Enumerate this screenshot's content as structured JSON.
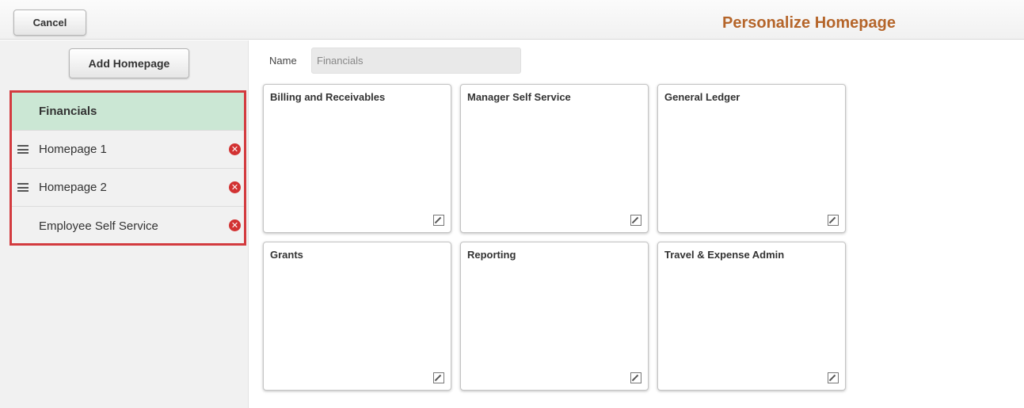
{
  "header": {
    "cancel_label": "Cancel",
    "title": "Personalize Homepage"
  },
  "sidebar": {
    "add_label": "Add Homepage",
    "items": [
      {
        "label": "Financials",
        "selected": true,
        "drag_icon": false,
        "delete_icon": false
      },
      {
        "label": "Homepage 1",
        "selected": false,
        "drag_icon": true,
        "delete_icon": true
      },
      {
        "label": "Homepage 2",
        "selected": false,
        "drag_icon": true,
        "delete_icon": true
      },
      {
        "label": "Employee Self Service",
        "selected": false,
        "drag_icon": false,
        "delete_icon": true
      }
    ],
    "delete_icon_glyph": "✕"
  },
  "main": {
    "name_label": "Name",
    "name_value": "Financials",
    "tiles": [
      {
        "title": "Billing and Receivables",
        "icon": "edit-icon"
      },
      {
        "title": "Manager Self Service",
        "icon": "edit-icon"
      },
      {
        "title": "General Ledger",
        "icon": "edit-icon"
      },
      {
        "title": "Grants",
        "icon": "edit-icon"
      },
      {
        "title": "Reporting",
        "icon": "edit-icon"
      },
      {
        "title": "Travel & Expense Admin",
        "icon": "edit-icon"
      }
    ]
  },
  "colors": {
    "title_accent": "#b5652a",
    "selected_row": "#cbe7d4",
    "highlight_border": "#d33b3f",
    "delete_icon": "#d23232"
  }
}
